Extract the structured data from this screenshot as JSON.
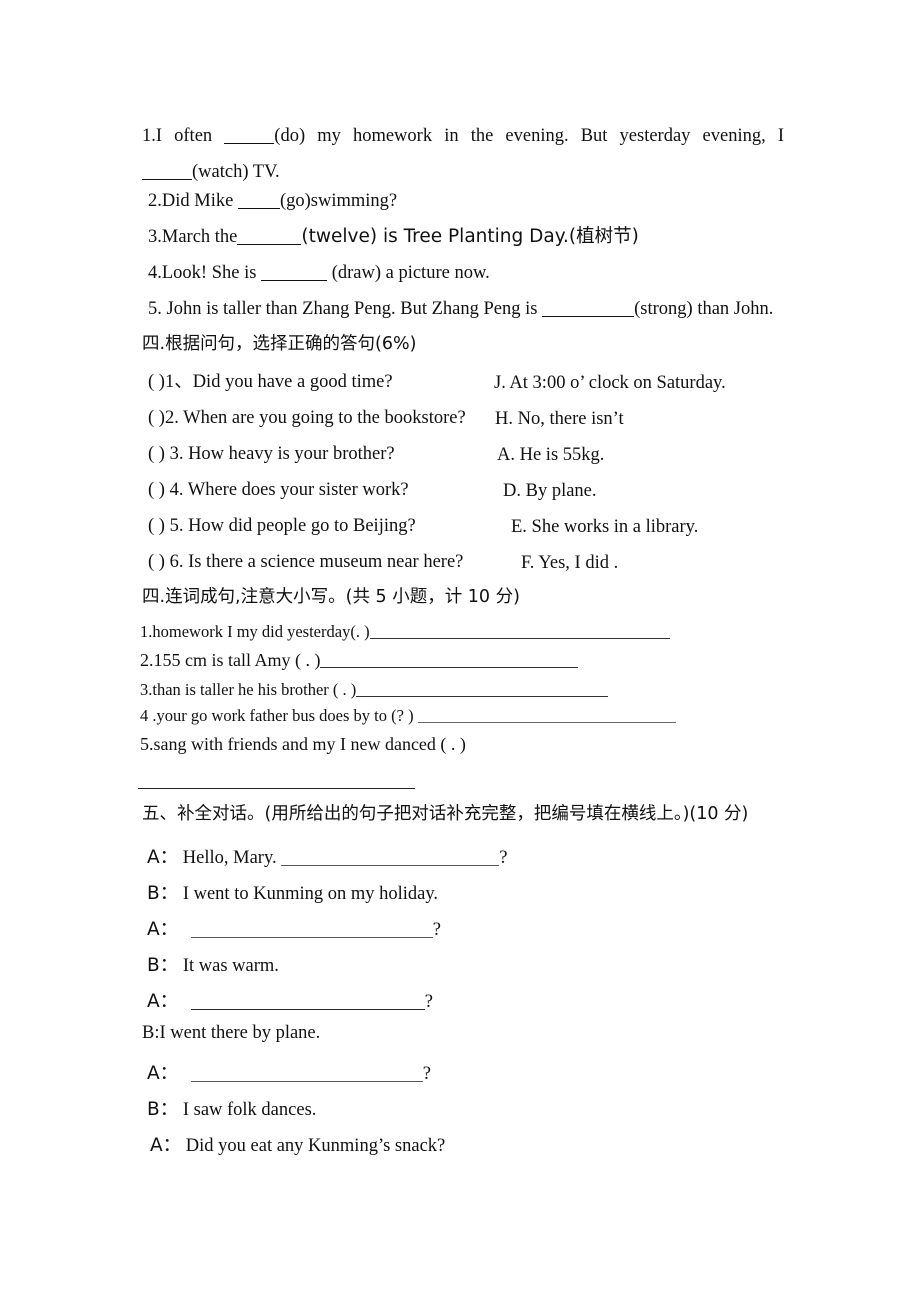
{
  "document": {
    "type": "english-exam-worksheet",
    "background_color": "#ffffff",
    "text_color": "#111111"
  },
  "fill_in_blanks": {
    "items": [
      {
        "number": "1.",
        "line1_pre": "1.I  often",
        "line1_post": "(do)  my  homework  in  the  evening. But  yesterday  evening,  I",
        "line2_post": "(watch) TV.",
        "full_text": "1.I often _____(do) my homework in the evening. But yesterday evening, I _____(watch) TV."
      },
      {
        "number": "2.",
        "pre": "2.Did Mike",
        "post": "(go)swimming?",
        "full_text": "2.Did Mike ____(go)swimming?"
      },
      {
        "number": "3.",
        "pre": "3.March the",
        "post": "(twelve) is Tree Planting Day.(植树节)",
        "full_text": "3.March the_______(twelve) is Tree Planting Day.(植树节)"
      },
      {
        "number": "4.",
        "pre": "4.Look! She is",
        "post": "(draw) a picture now.",
        "full_text": "4.Look! She is _______ (draw) a picture now."
      },
      {
        "number": "5.",
        "pre": "5. John is taller than Zhang Peng. But Zhang Peng is",
        "post": "(strong) than John.",
        "full_text": "5. John is taller than Zhang Peng. But Zhang Peng is __________(strong) than John."
      }
    ]
  },
  "matching_section": {
    "heading": "四.根据问句，选择正确的答句(6%)",
    "questions": [
      "( )1、Did you have a good time?",
      "( )2. When are you going to the bookstore?",
      "( ) 3. How heavy is your brother?",
      "( ) 4. Where does your sister work?",
      "( ) 5. How did people go to Beijing?",
      "( ) 6. Is there a science museum near here?"
    ],
    "answers": [
      "J. At 3:00 o’ clock on Saturday.",
      "H. No, there isn’t",
      "A. He is 55kg.",
      "D. By plane.",
      "E. She works in a library.",
      "F. Yes, I did ."
    ]
  },
  "word_order_section": {
    "heading": "四.连词成句,注意大小写。(共 5 小题，计 10 分)",
    "items": [
      "1.homework   I   my   did yesterday(. )",
      "2.155 cm   is tall   Amy ( . )",
      "3.than   is   taller   he   his   brother ( . )",
      "4 .your   go   work   father   bus   does   by to (? )",
      "5.sang   with   friends   and   my   I   new danced ( . )"
    ]
  },
  "dialogue_section": {
    "heading": "五、补全对话。(用所给出的句子把对话补充完整，把编号填在横线上。)(10 分)",
    "lines": [
      {
        "speaker": "A：",
        "text": "Hello, Mary.",
        "has_blank": true,
        "trailing": "?"
      },
      {
        "speaker": "B：",
        "text": "I went to Kunming on my holiday.",
        "has_blank": false,
        "trailing": ""
      },
      {
        "speaker": "A：",
        "text": "",
        "has_blank": true,
        "trailing": "?"
      },
      {
        "speaker": "B：",
        "text": "It was warm.",
        "has_blank": false,
        "trailing": ""
      },
      {
        "speaker": "A：",
        "text": "",
        "has_blank": true,
        "trailing": "?"
      },
      {
        "speaker": "B:",
        "text": "I went there by plane.",
        "has_blank": false,
        "trailing": ""
      },
      {
        "speaker": "A：",
        "text": "",
        "has_blank": true,
        "trailing": "?"
      },
      {
        "speaker": "B：",
        "text": "I saw folk dances.",
        "has_blank": false,
        "trailing": ""
      },
      {
        "speaker": "A：",
        "text": "Did you eat any Kunming’s snack?",
        "has_blank": false,
        "trailing": ""
      }
    ]
  }
}
